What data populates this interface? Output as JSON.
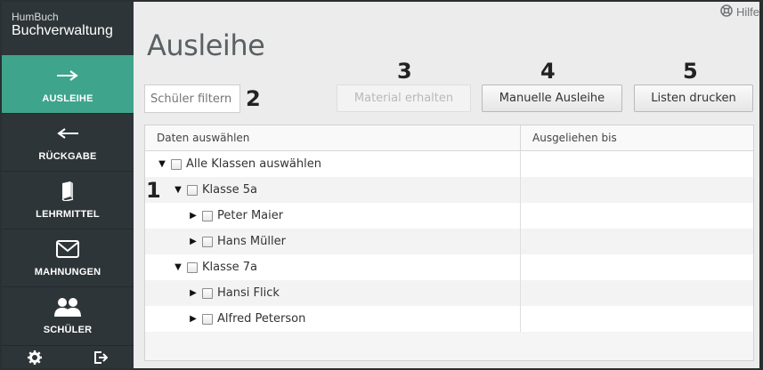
{
  "brand": {
    "top": "HumBuch",
    "main": "Buchverwaltung"
  },
  "sidebar": {
    "items": [
      {
        "label": "AUSLEIHE",
        "icon": "arrow-right-icon",
        "active": true
      },
      {
        "label": "RÜCKGABE",
        "icon": "arrow-left-icon",
        "active": false
      },
      {
        "label": "LEHRMITTEL",
        "icon": "book-icon",
        "active": false
      },
      {
        "label": "MAHNUNGEN",
        "icon": "envelope-icon",
        "active": false
      },
      {
        "label": "SCHÜLER",
        "icon": "users-icon",
        "active": false
      }
    ],
    "bottom": [
      "gear-icon",
      "logout-icon"
    ]
  },
  "help": {
    "label": "Hilfe",
    "icon": "lifebuoy-icon"
  },
  "page": {
    "title": "Ausleihe"
  },
  "filter": {
    "placeholder": "Schüler filtern"
  },
  "toolbar": {
    "material_label": "Material erhalten",
    "manual_label": "Manuelle Ausleihe",
    "print_label": "Listen drucken"
  },
  "markers": {
    "m1": "1",
    "m2": "2",
    "m3": "3",
    "m4": "4",
    "m5": "5"
  },
  "grid": {
    "columns": [
      "Daten auswählen",
      "Ausgeliehen bis"
    ],
    "rows": [
      {
        "label": "Alle Klassen auswählen",
        "toggle": "▼",
        "level": 0,
        "due": ""
      },
      {
        "label": "Klasse 5a",
        "toggle": "▼",
        "level": 1,
        "due": ""
      },
      {
        "label": "Peter Maier",
        "toggle": "▶",
        "level": 2,
        "due": ""
      },
      {
        "label": "Hans Müller",
        "toggle": "▶",
        "level": 2,
        "due": ""
      },
      {
        "label": "Klasse 7a",
        "toggle": "▼",
        "level": 1,
        "due": ""
      },
      {
        "label": "Hansi Flick",
        "toggle": "▶",
        "level": 2,
        "due": ""
      },
      {
        "label": "Alfred Peterson",
        "toggle": "▶",
        "level": 2,
        "due": ""
      }
    ]
  },
  "colors": {
    "accent": "#3fa48c",
    "sidebar": "#2e3538",
    "content": "#ececec"
  }
}
